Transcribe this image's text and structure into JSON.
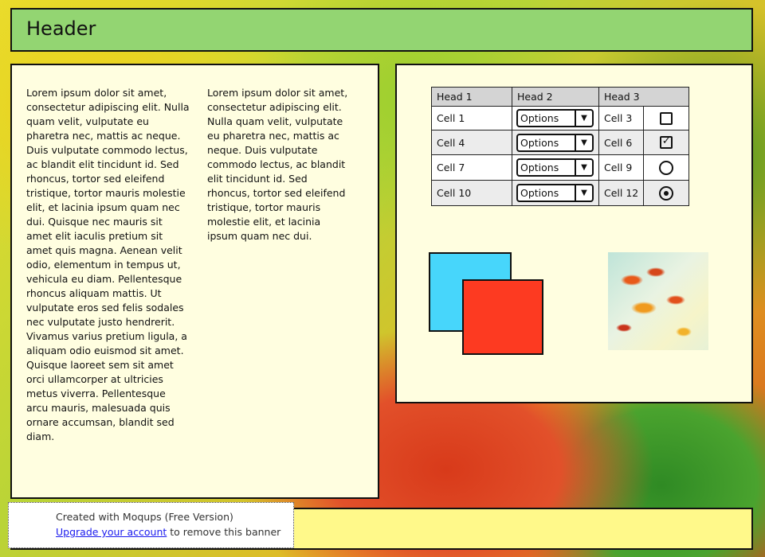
{
  "header": {
    "title": "Header"
  },
  "text_panel": {
    "column1": "Lorem ipsum dolor sit amet, consectetur adipiscing elit. Nulla quam velit, vulputate eu pharetra nec, mattis ac neque. Duis vulputate commodo lectus, ac blandit elit tincidunt id. Sed rhoncus, tortor sed eleifend tristique, tortor mauris molestie elit, et lacinia ipsum quam nec dui. Quisque nec mauris sit amet elit iaculis pretium sit amet quis magna. Aenean velit odio, elementum in tempus ut, vehicula eu diam. Pellentesque rhoncus aliquam mattis. Ut vulputate eros sed felis sodales nec vulputate justo hendrerit. Vivamus varius pretium ligula, a aliquam odio euismod sit amet. Quisque laoreet sem sit amet orci ullamcorper at ultricies metus viverra. Pellentesque arcu mauris, malesuada quis ornare accumsan, blandit sed diam.",
    "column2": "Lorem ipsum dolor sit amet, consectetur adipiscing elit. Nulla quam velit, vulputate eu pharetra nec, mattis ac neque. Duis vulputate commodo lectus, ac blandit elit tincidunt id. Sed rhoncus, tortor sed eleifend tristique, tortor mauris molestie elit, et lacinia ipsum quam nec dui."
  },
  "table": {
    "headers": [
      "Head 1",
      "Head 2",
      "Head 3"
    ],
    "rows": [
      {
        "cell1": "Cell 1",
        "select": "Options",
        "cell3": "Cell 3",
        "control": "checkbox",
        "checked": false
      },
      {
        "cell1": "Cell 4",
        "select": "Options",
        "cell3": "Cell 6",
        "control": "checkbox",
        "checked": true
      },
      {
        "cell1": "Cell 7",
        "select": "Options",
        "cell3": "Cell 9",
        "control": "radio",
        "checked": false
      },
      {
        "cell1": "Cell 10",
        "select": "Options",
        "cell3": "Cell 12",
        "control": "radio",
        "checked": true
      }
    ],
    "check_mark": "✓",
    "select_arrow": "▼"
  },
  "shapes": {
    "blue": "#47d6fb",
    "red": "#fd3a21"
  },
  "colors": {
    "header_bg": "#93d572",
    "panel_bg": "#fffee0",
    "footer_bg": "#fff98a"
  },
  "banner": {
    "line1": "Created with Moqups (Free Version)",
    "link": "Upgrade your account",
    "line2_suffix": " to remove this banner"
  }
}
